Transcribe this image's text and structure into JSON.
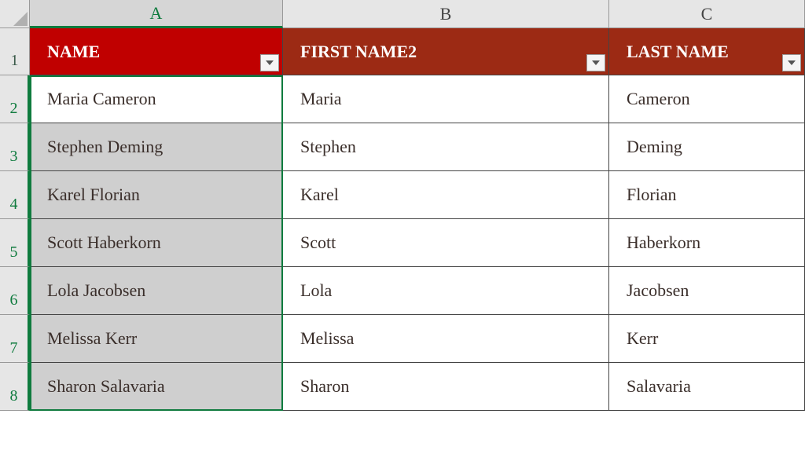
{
  "columns": {
    "a": "A",
    "b": "B",
    "c": "C"
  },
  "headers": {
    "name": "NAME",
    "first": "FIRST NAME2",
    "last": "LAST NAME"
  },
  "rownums": {
    "r1": "1",
    "r2": "2",
    "r3": "3",
    "r4": "4",
    "r5": "5",
    "r6": "6",
    "r7": "7",
    "r8": "8"
  },
  "rows": [
    {
      "name": "Maria Cameron",
      "first": "Maria",
      "last": "Cameron"
    },
    {
      "name": "Stephen Deming",
      "first": "Stephen",
      "last": "Deming"
    },
    {
      "name": "Karel Florian",
      "first": "Karel",
      "last": "Florian"
    },
    {
      "name": "Scott Haberkorn",
      "first": "Scott",
      "last": "Haberkorn"
    },
    {
      "name": "Lola Jacobsen",
      "first": "Lola",
      "last": "Jacobsen"
    },
    {
      "name": "Melissa Kerr",
      "first": "Melissa",
      "last": "Kerr"
    },
    {
      "name": "Sharon Salavaria",
      "first": "Sharon",
      "last": "Salavaria"
    }
  ],
  "selection": {
    "range": "A2:A8",
    "active": "A2"
  }
}
